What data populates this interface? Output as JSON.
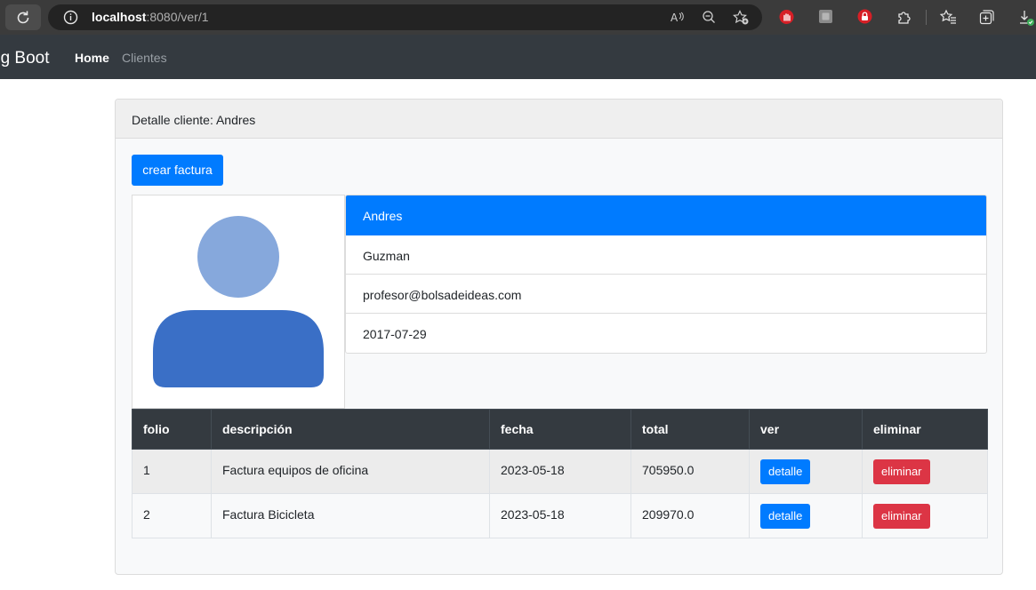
{
  "browser": {
    "url_host": "localhost",
    "url_path": ":8080/ver/1"
  },
  "navbar": {
    "brand": "ng Boot",
    "links": [
      "Home",
      "Clientes"
    ]
  },
  "card": {
    "header": "Detalle cliente: Andres",
    "create_button": "crear factura"
  },
  "client": {
    "items": [
      "Andres",
      "Guzman",
      "profesor@bolsadeideas.com",
      "2017-07-29"
    ]
  },
  "table": {
    "headers": [
      "folio",
      "descripción",
      "fecha",
      "total",
      "ver",
      "eliminar"
    ],
    "rows": [
      {
        "folio": "1",
        "descripcion": "Factura equipos de oficina",
        "fecha": "2023-05-18",
        "total": "705950.0",
        "ver": "detalle",
        "eliminar": "eliminar"
      },
      {
        "folio": "2",
        "descripcion": "Factura Bicicleta",
        "fecha": "2023-05-18",
        "total": "209970.0",
        "ver": "detalle",
        "eliminar": "eliminar"
      }
    ]
  },
  "colors": {
    "primary": "#007bff",
    "danger": "#dc3545",
    "dark": "#343a40",
    "avatar_head": "#86a8dc",
    "avatar_body": "#3a6fc6"
  }
}
